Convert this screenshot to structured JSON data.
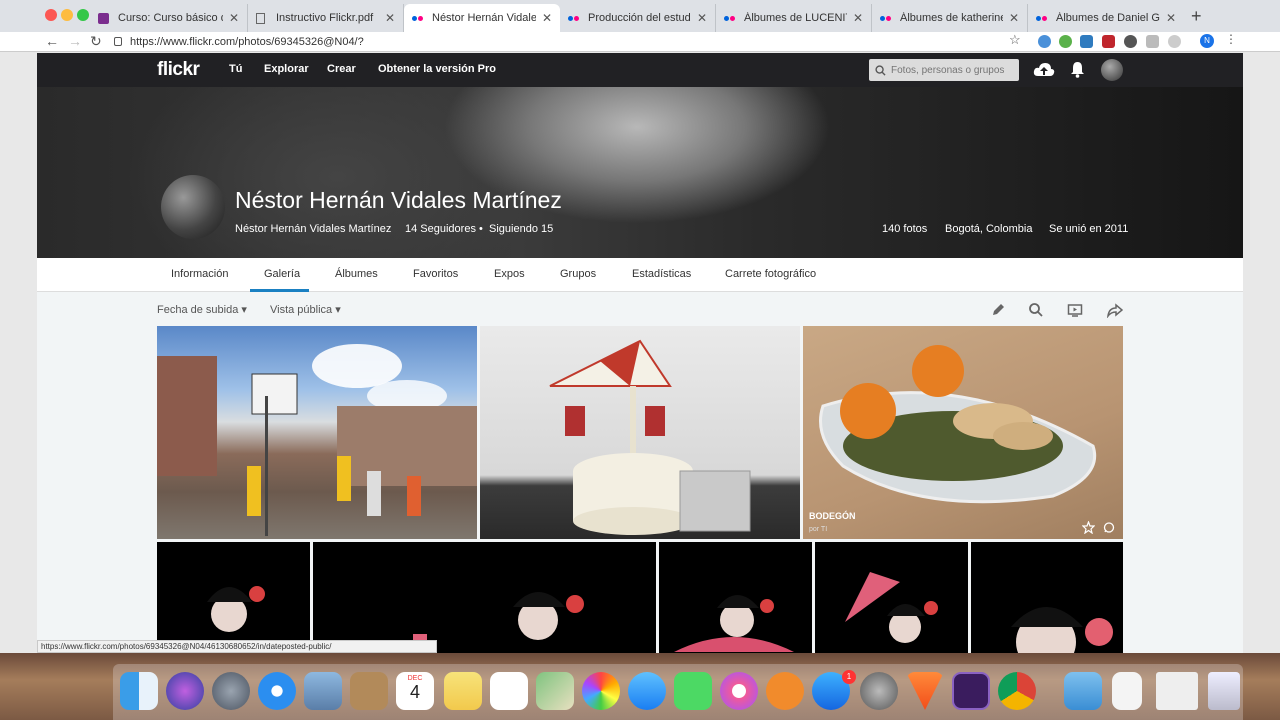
{
  "browser": {
    "tabs": [
      {
        "title": "Curso: Curso básico de fotog",
        "favicon_color": "#7b2d8e"
      },
      {
        "title": "Instructivo Flickr.pdf",
        "favicon_color": "#666666"
      },
      {
        "title": "Néstor Hernán Vidales Martín",
        "favicon_color": "#0063dc",
        "active": true
      },
      {
        "title": "Producción del estudiante IIl",
        "favicon_color": "#0063dc"
      },
      {
        "title": "Álbumes de LUCENITH CARR",
        "favicon_color": "#0063dc"
      },
      {
        "title": "Álbumes de katherineosma",
        "favicon_color": "#0063dc"
      },
      {
        "title": "Álbumes de Daniel González",
        "favicon_color": "#0063dc"
      }
    ],
    "url": "https://www.flickr.com/photos/69345326@N04/?",
    "status_url": "https://www.flickr.com/photos/69345326@N04/46130680652/in/dateposted-public/",
    "profile_initial": "N"
  },
  "flickr": {
    "logo": "flickr",
    "nav": [
      "Tú",
      "Explorar",
      "Crear",
      "Obtener la versión Pro"
    ],
    "search_placeholder": "Fotos, personas o grupos",
    "brand_blue": "#0063dc",
    "brand_pink": "#ff0084"
  },
  "profile": {
    "name": "Néstor Hernán Vidales Martínez",
    "username": "Néstor Hernán Vidales Martínez",
    "followers": "14 Seguidores",
    "following": "Siguiendo 15",
    "photos": "140 fotos",
    "location": "Bogotá, Colombia",
    "joined": "Se unió en 2011"
  },
  "subnav": {
    "tabs": [
      "Información",
      "Galería",
      "Álbumes",
      "Favoritos",
      "Expos",
      "Grupos",
      "Estadísticas",
      "Carrete fotográfico"
    ],
    "active": "Galería",
    "accent": "#1a80c2"
  },
  "gallery": {
    "sort": "Fecha de subida",
    "visibility": "Vista pública",
    "tools": [
      "pencil-icon",
      "search-icon",
      "slideshow-icon",
      "share-icon"
    ],
    "row1": [
      {
        "title": "",
        "by": ""
      },
      {
        "title": "",
        "by": ""
      },
      {
        "title": "BODEGÓN",
        "by": "por TI"
      }
    ]
  },
  "dock": {
    "calendar_month": "DEC",
    "calendar_day": "4",
    "appstore_badge": "1"
  }
}
